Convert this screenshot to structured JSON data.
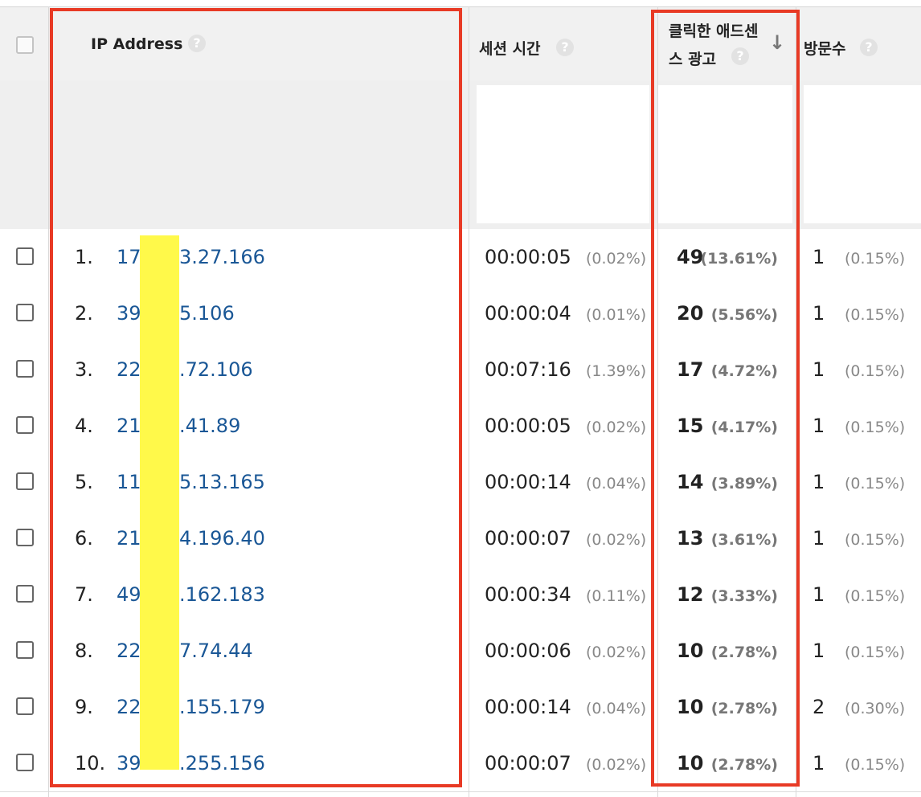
{
  "header": {
    "ip_label": "IP Address",
    "session_label": "세션 시간",
    "adsense_label_line1": "클릭한 애드센",
    "adsense_label_line2": "스 광고",
    "visits_label": "방문수",
    "help_glyph": "?",
    "sort_glyph": "↓"
  },
  "rows": [
    {
      "rank": "1.",
      "ip_start": "17",
      "ip_end": "3.27.166",
      "session": "00:00:05",
      "session_pct": "(0.02%)",
      "clicks": "49",
      "clicks_pct": "(13.61%)",
      "visits": "1",
      "visits_pct": "(0.15%)"
    },
    {
      "rank": "2.",
      "ip_start": "39",
      "ip_end": "5.106",
      "session": "00:00:04",
      "session_pct": "(0.01%)",
      "clicks": "20",
      "clicks_pct": "(5.56%)",
      "visits": "1",
      "visits_pct": "(0.15%)"
    },
    {
      "rank": "3.",
      "ip_start": "22",
      "ip_end": ".72.106",
      "session": "00:07:16",
      "session_pct": "(1.39%)",
      "clicks": "17",
      "clicks_pct": "(4.72%)",
      "visits": "1",
      "visits_pct": "(0.15%)"
    },
    {
      "rank": "4.",
      "ip_start": "21",
      "ip_end": ".41.89",
      "session": "00:00:05",
      "session_pct": "(0.02%)",
      "clicks": "15",
      "clicks_pct": "(4.17%)",
      "visits": "1",
      "visits_pct": "(0.15%)"
    },
    {
      "rank": "5.",
      "ip_start": "11",
      "ip_end": "5.13.165",
      "session": "00:00:14",
      "session_pct": "(0.04%)",
      "clicks": "14",
      "clicks_pct": "(3.89%)",
      "visits": "1",
      "visits_pct": "(0.15%)"
    },
    {
      "rank": "6.",
      "ip_start": "21",
      "ip_end": "4.196.40",
      "session": "00:00:07",
      "session_pct": "(0.02%)",
      "clicks": "13",
      "clicks_pct": "(3.61%)",
      "visits": "1",
      "visits_pct": "(0.15%)"
    },
    {
      "rank": "7.",
      "ip_start": "49",
      "ip_end": ".162.183",
      "session": "00:00:34",
      "session_pct": "(0.11%)",
      "clicks": "12",
      "clicks_pct": "(3.33%)",
      "visits": "1",
      "visits_pct": "(0.15%)"
    },
    {
      "rank": "8.",
      "ip_start": "22",
      "ip_end": "7.74.44",
      "session": "00:00:06",
      "session_pct": "(0.02%)",
      "clicks": "10",
      "clicks_pct": "(2.78%)",
      "visits": "1",
      "visits_pct": "(0.15%)"
    },
    {
      "rank": "9.",
      "ip_start": "22",
      "ip_end": ".155.179",
      "session": "00:00:14",
      "session_pct": "(0.04%)",
      "clicks": "10",
      "clicks_pct": "(2.78%)",
      "visits": "2",
      "visits_pct": "(0.30%)"
    },
    {
      "rank": "10.",
      "ip_start": "39",
      "ip_end": ".255.156",
      "session": "00:00:07",
      "session_pct": "(0.02%)",
      "clicks": "10",
      "clicks_pct": "(2.78%)",
      "visits": "1",
      "visits_pct": "(0.15%)"
    }
  ],
  "colors": {
    "link": "#1a5796",
    "annotation_red": "#e83a25",
    "redaction_yellow": "#fff94a",
    "header_bg": "#f1f1f1"
  }
}
